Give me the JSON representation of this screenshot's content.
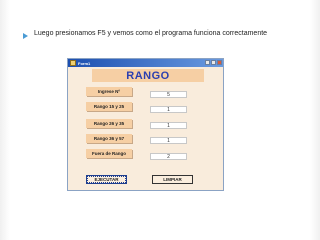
{
  "slide": {
    "text": "Luego presionamos F5 y vemos como el programa funciona correctamente"
  },
  "window": {
    "title": "Form1",
    "heading": "RANGO",
    "rows": [
      {
        "label": "Ingrese  Nº",
        "value": "5"
      },
      {
        "label": "Rango 15 y 25",
        "value": "1"
      },
      {
        "label": "Rango 26 y 35",
        "value": "1"
      },
      {
        "label": "Rango 36 y 57",
        "value": "1"
      },
      {
        "label": "Fuera de Rango",
        "value": "2"
      }
    ],
    "buttons": {
      "execute": "EJECUTAR",
      "clear": "LIMPIAR"
    }
  },
  "colors": {
    "bullet": "#4a9bd4",
    "heading_text": "#2b3fb0",
    "label_bg": "#f6cfa4",
    "form_bg": "#f9ecdc",
    "titlebar": "#1c4fb0"
  },
  "icons": [
    "app-icon",
    "minimize-icon",
    "maximize-icon",
    "close-icon",
    "bullet-arrow-icon"
  ]
}
